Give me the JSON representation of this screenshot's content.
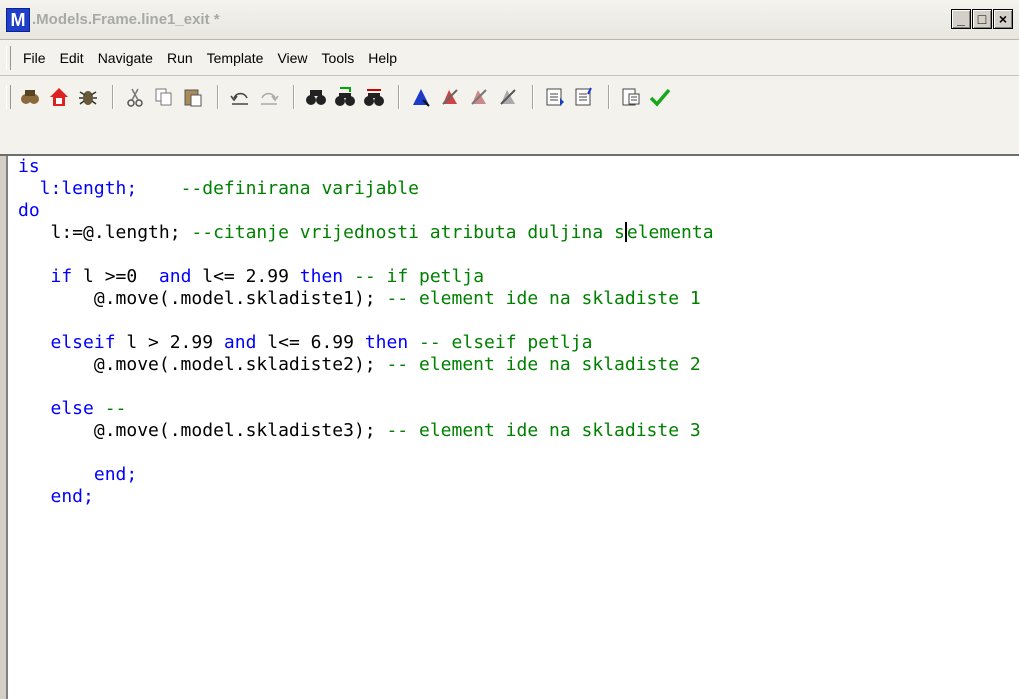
{
  "window": {
    "app_icon": "M",
    "title": ".Models.Frame.line1_exit *",
    "controls": {
      "minimize": "_",
      "maximize": "□",
      "close": "×"
    }
  },
  "menu": [
    "File",
    "Edit",
    "Navigate",
    "Run",
    "Template",
    "View",
    "Tools",
    "Help"
  ],
  "toolbar": {
    "groups": [
      [
        "binoculars-users-icon",
        "home-icon",
        "bug-icon"
      ],
      [
        "cut-icon",
        "copy-icon",
        "paste-icon"
      ],
      [
        "undo-icon",
        "redo-icon"
      ],
      [
        "find-icon",
        "find-next-icon",
        "replace-icon"
      ],
      [
        "bookmark-icon",
        "toggle-breakpoint-icon",
        "next-breakpoint-icon",
        "clear-breakpoints-icon"
      ],
      [
        "comment-icon",
        "uncomment-icon"
      ],
      [
        "format-icon",
        "check-icon"
      ]
    ]
  },
  "code": {
    "lines": [
      [
        {
          "t": "is",
          "c": "kw"
        }
      ],
      [
        {
          "t": "  l:length;    ",
          "c": "kw"
        },
        {
          "t": "--definirana varijable",
          "c": "cm"
        }
      ],
      [
        {
          "t": "do",
          "c": "kw"
        }
      ],
      [
        {
          "t": "   l:=@.length; ",
          "c": "plain"
        },
        {
          "t": "--citanje vrijednosti atributa duljina s",
          "c": "cm"
        },
        {
          "t": "|",
          "c": "cursor"
        },
        {
          "t": "elementa",
          "c": "cm"
        }
      ],
      [
        {
          "t": "",
          "c": "plain"
        }
      ],
      [
        {
          "t": "   if ",
          "c": "kw"
        },
        {
          "t": "l >=0  ",
          "c": "plain"
        },
        {
          "t": "and ",
          "c": "kw"
        },
        {
          "t": "l<= 2.99 ",
          "c": "plain"
        },
        {
          "t": "then ",
          "c": "kw"
        },
        {
          "t": "-- if petlja",
          "c": "cm"
        }
      ],
      [
        {
          "t": "       @.move(.model.skladiste1); ",
          "c": "plain"
        },
        {
          "t": "-- element ide na skladiste 1",
          "c": "cm"
        }
      ],
      [
        {
          "t": "",
          "c": "plain"
        }
      ],
      [
        {
          "t": "   elseif ",
          "c": "kw"
        },
        {
          "t": "l > 2.99 ",
          "c": "plain"
        },
        {
          "t": "and ",
          "c": "kw"
        },
        {
          "t": "l<= 6.99 ",
          "c": "plain"
        },
        {
          "t": "then ",
          "c": "kw"
        },
        {
          "t": "-- elseif petlja",
          "c": "cm"
        }
      ],
      [
        {
          "t": "       @.move(.model.skladiste2); ",
          "c": "plain"
        },
        {
          "t": "-- element ide na skladiste 2",
          "c": "cm"
        }
      ],
      [
        {
          "t": "",
          "c": "plain"
        }
      ],
      [
        {
          "t": "   else ",
          "c": "kw"
        },
        {
          "t": "--",
          "c": "cm"
        }
      ],
      [
        {
          "t": "       @.move(.model.skladiste3); ",
          "c": "plain"
        },
        {
          "t": "-- element ide na skladiste 3",
          "c": "cm"
        }
      ],
      [
        {
          "t": "",
          "c": "plain"
        }
      ],
      [
        {
          "t": "       end;",
          "c": "kw"
        }
      ],
      [
        {
          "t": "   end;",
          "c": "kw"
        }
      ]
    ]
  },
  "colors": {
    "keyword": "#0000ff",
    "comment": "#008000",
    "text": "#000000"
  }
}
